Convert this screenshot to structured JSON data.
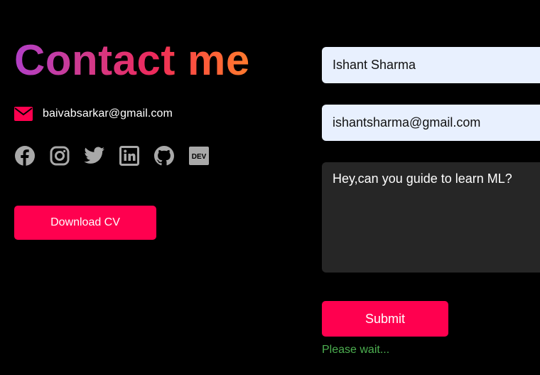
{
  "contact": {
    "title": "Contact me",
    "email": "baivabsarkar@gmail.com",
    "download_label": "Download CV",
    "socials": [
      {
        "name": "facebook",
        "icon": "facebook-icon"
      },
      {
        "name": "instagram",
        "icon": "instagram-icon"
      },
      {
        "name": "twitter",
        "icon": "twitter-icon"
      },
      {
        "name": "linkedin",
        "icon": "linkedin-icon"
      },
      {
        "name": "github",
        "icon": "github-icon"
      },
      {
        "name": "dev",
        "icon": "dev-icon",
        "label": "DEV"
      }
    ]
  },
  "form": {
    "name_value": "Ishant Sharma",
    "email_value": "ishantsharma@gmail.com",
    "message_value": "Hey,can you guide to learn ML?",
    "submit_label": "Submit",
    "status_text": "Please wait..."
  },
  "colors": {
    "background": "#000000",
    "accent": "#ff004f",
    "icon_gray": "#a9a9a9",
    "status_green": "#4caf50",
    "input_bg": "#e8f0fe",
    "textarea_bg": "#262626"
  }
}
